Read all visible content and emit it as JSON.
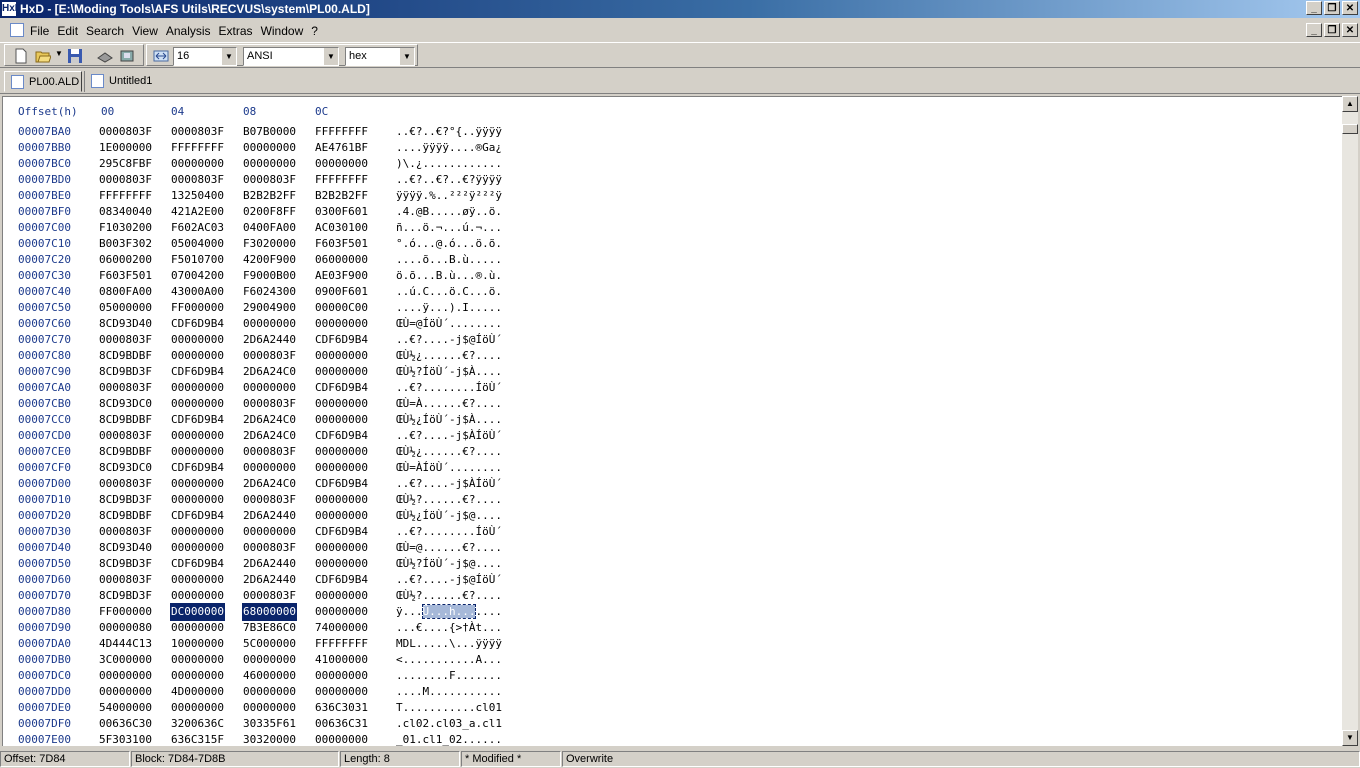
{
  "window": {
    "title": "HxD - [E:\\Moding Tools\\AFS Utils\\RECVUS\\system\\PL00.ALD]",
    "app_icon": "HxD"
  },
  "menu": [
    "File",
    "Edit",
    "Search",
    "View",
    "Analysis",
    "Extras",
    "Window",
    "?"
  ],
  "toolbar": {
    "bytes_per_row": "16",
    "charset": "ANSI",
    "offset_base": "hex"
  },
  "tabs": [
    {
      "label": "PL00.ALD",
      "active": true
    },
    {
      "label": "Untitled1",
      "active": false
    }
  ],
  "editor": {
    "header": {
      "offset": "Offset(h)",
      "cols": [
        "00",
        "04",
        "08",
        "0C"
      ]
    },
    "rows": [
      {
        "offset": "00007BA0",
        "g": [
          "0000803F",
          "0000803F",
          "B07B0000",
          "FFFFFFFF"
        ],
        "text": "..€?..€?°{..ÿÿÿÿ"
      },
      {
        "offset": "00007BB0",
        "g": [
          "1E000000",
          "FFFFFFFF",
          "00000000",
          "AE4761BF"
        ],
        "text": "....ÿÿÿÿ....®Ga¿"
      },
      {
        "offset": "00007BC0",
        "g": [
          "295C8FBF",
          "00000000",
          "00000000",
          "00000000"
        ],
        "text": ")\\.¿............"
      },
      {
        "offset": "00007BD0",
        "g": [
          "0000803F",
          "0000803F",
          "0000803F",
          "FFFFFFFF"
        ],
        "text": "..€?..€?..€?ÿÿÿÿ"
      },
      {
        "offset": "00007BE0",
        "g": [
          "FFFFFFFF",
          "13250400",
          "B2B2B2FF",
          "B2B2B2FF"
        ],
        "text": "ÿÿÿÿ.%..²²²ÿ²²²ÿ"
      },
      {
        "offset": "00007BF0",
        "g": [
          "08340040",
          "421A2E00",
          "0200F8FF",
          "0300F601"
        ],
        "text": ".4.@B.....øÿ..ö."
      },
      {
        "offset": "00007C00",
        "g": [
          "F1030200",
          "F602AC03",
          "0400FA00",
          "AC030100"
        ],
        "text": "ñ...ö.¬...ú.¬..."
      },
      {
        "offset": "00007C10",
        "g": [
          "B003F302",
          "05004000",
          "F3020000",
          "F603F501"
        ],
        "text": "°.ó...@.ó...ö.õ."
      },
      {
        "offset": "00007C20",
        "g": [
          "06000200",
          "F5010700",
          "4200F900",
          "06000000"
        ],
        "text": "....õ...B.ù....."
      },
      {
        "offset": "00007C30",
        "g": [
          "F603F501",
          "07004200",
          "F9000B00",
          "AE03F900"
        ],
        "text": "ö.õ...B.ù...®.ù."
      },
      {
        "offset": "00007C40",
        "g": [
          "0800FA00",
          "43000A00",
          "F6024300",
          "0900F601"
        ],
        "text": "..ú.C...ö.C...ö."
      },
      {
        "offset": "00007C50",
        "g": [
          "05000000",
          "FF000000",
          "29004900",
          "00000C00"
        ],
        "text": "....ÿ...).I....."
      },
      {
        "offset": "00007C60",
        "g": [
          "8CD93D40",
          "CDF6D9B4",
          "00000000",
          "00000000"
        ],
        "text": "ŒÙ=@ÍöÙ´........"
      },
      {
        "offset": "00007C70",
        "g": [
          "0000803F",
          "00000000",
          "2D6A2440",
          "CDF6D9B4"
        ],
        "text": "..€?....-j$@ÍöÙ´"
      },
      {
        "offset": "00007C80",
        "g": [
          "8CD9BDBF",
          "00000000",
          "0000803F",
          "00000000"
        ],
        "text": "ŒÙ½¿......€?...."
      },
      {
        "offset": "00007C90",
        "g": [
          "8CD9BD3F",
          "CDF6D9B4",
          "2D6A24C0",
          "00000000"
        ],
        "text": "ŒÙ½?ÍöÙ´-j$À...."
      },
      {
        "offset": "00007CA0",
        "g": [
          "0000803F",
          "00000000",
          "00000000",
          "CDF6D9B4"
        ],
        "text": "..€?........ÍöÙ´"
      },
      {
        "offset": "00007CB0",
        "g": [
          "8CD93DC0",
          "00000000",
          "0000803F",
          "00000000"
        ],
        "text": "ŒÙ=À......€?...."
      },
      {
        "offset": "00007CC0",
        "g": [
          "8CD9BDBF",
          "CDF6D9B4",
          "2D6A24C0",
          "00000000"
        ],
        "text": "ŒÙ½¿ÍöÙ´-j$À...."
      },
      {
        "offset": "00007CD0",
        "g": [
          "0000803F",
          "00000000",
          "2D6A24C0",
          "CDF6D9B4"
        ],
        "text": "..€?....-j$ÀÍöÙ´"
      },
      {
        "offset": "00007CE0",
        "g": [
          "8CD9BDBF",
          "00000000",
          "0000803F",
          "00000000"
        ],
        "text": "ŒÙ½¿......€?...."
      },
      {
        "offset": "00007CF0",
        "g": [
          "8CD93DC0",
          "CDF6D9B4",
          "00000000",
          "00000000"
        ],
        "text": "ŒÙ=ÀÍöÙ´........"
      },
      {
        "offset": "00007D00",
        "g": [
          "0000803F",
          "00000000",
          "2D6A24C0",
          "CDF6D9B4"
        ],
        "text": "..€?....-j$ÀÍöÙ´"
      },
      {
        "offset": "00007D10",
        "g": [
          "8CD9BD3F",
          "00000000",
          "0000803F",
          "00000000"
        ],
        "text": "ŒÙ½?......€?...."
      },
      {
        "offset": "00007D20",
        "g": [
          "8CD9BDBF",
          "CDF6D9B4",
          "2D6A2440",
          "00000000"
        ],
        "text": "ŒÙ½¿ÍöÙ´-j$@...."
      },
      {
        "offset": "00007D30",
        "g": [
          "0000803F",
          "00000000",
          "00000000",
          "CDF6D9B4"
        ],
        "text": "..€?........ÍöÙ´"
      },
      {
        "offset": "00007D40",
        "g": [
          "8CD93D40",
          "00000000",
          "0000803F",
          "00000000"
        ],
        "text": "ŒÙ=@......€?...."
      },
      {
        "offset": "00007D50",
        "g": [
          "8CD9BD3F",
          "CDF6D9B4",
          "2D6A2440",
          "00000000"
        ],
        "text": "ŒÙ½?ÍöÙ´-j$@...."
      },
      {
        "offset": "00007D60",
        "g": [
          "0000803F",
          "00000000",
          "2D6A2440",
          "CDF6D9B4"
        ],
        "text": "..€?....-j$@ÍöÙ´"
      },
      {
        "offset": "00007D70",
        "g": [
          "8CD9BD3F",
          "00000000",
          "0000803F",
          "00000000"
        ],
        "text": "ŒÙ½?......€?...."
      },
      {
        "offset": "00007D80",
        "g": [
          "FF000000",
          "DC000000",
          "68000000",
          "00000000"
        ],
        "text": "ÿ...Ü...h.......",
        "selected": true
      },
      {
        "offset": "00007D90",
        "g": [
          "00000080",
          "00000000",
          "7B3E86C0",
          "74000000"
        ],
        "text": "...€....{>†Àt..."
      },
      {
        "offset": "00007DA0",
        "g": [
          "4D444C13",
          "10000000",
          "5C000000",
          "FFFFFFFF"
        ],
        "text": "MDL.....\\...ÿÿÿÿ"
      },
      {
        "offset": "00007DB0",
        "g": [
          "3C000000",
          "00000000",
          "00000000",
          "41000000"
        ],
        "text": "<...........A..."
      },
      {
        "offset": "00007DC0",
        "g": [
          "00000000",
          "00000000",
          "46000000",
          "00000000"
        ],
        "text": "........F......."
      },
      {
        "offset": "00007DD0",
        "g": [
          "00000000",
          "4D000000",
          "00000000",
          "00000000"
        ],
        "text": "....M..........."
      },
      {
        "offset": "00007DE0",
        "g": [
          "54000000",
          "00000000",
          "00000000",
          "636C3031"
        ],
        "text": "T...........cl01"
      },
      {
        "offset": "00007DF0",
        "g": [
          "00636C30",
          "3200636C",
          "30335F61",
          "00636C31"
        ],
        "text": ".cl02.cl03_a.cl1"
      },
      {
        "offset": "00007E00",
        "g": [
          "5F303100",
          "636C315F",
          "30320000",
          "00000000"
        ],
        "text": "_01.cl1_02......"
      }
    ]
  },
  "status": {
    "offset": "Offset: 7D84",
    "block": "Block: 7D84-7D8B",
    "length": "Length: 8",
    "modified": "* Modified *",
    "mode": "Overwrite"
  },
  "colors": {
    "offset_text": "#1c3a8c",
    "selection": "#0a246a",
    "titlebar": "#0a246a"
  }
}
